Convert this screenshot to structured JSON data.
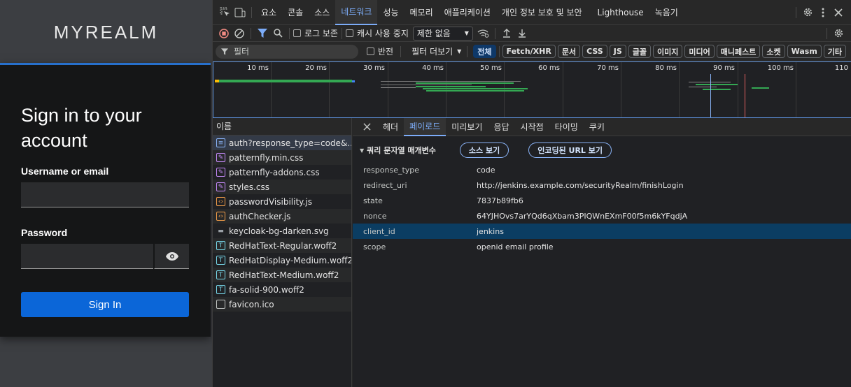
{
  "login": {
    "brand": "MYREALM",
    "heading": "Sign in to your account",
    "username_label": "Username or email",
    "username_value": "",
    "password_label": "Password",
    "password_value": "",
    "signin_label": "Sign In"
  },
  "devtools": {
    "tabs": [
      "요소",
      "콘솔",
      "소스",
      "네트워크",
      "성능",
      "메모리",
      "애플리케이션",
      "개인 정보 보호 및 보안",
      "Lighthouse",
      "녹음기"
    ],
    "active_tab": "네트워크",
    "toolbar": {
      "preserve_log": "로그 보존",
      "disable_cache": "캐시 사용 중지",
      "throttle": "제한 없음"
    },
    "filterbar": {
      "filter_placeholder": "필터",
      "invert": "반전",
      "more_filters": "필터 더보기",
      "chips": [
        "전체",
        "Fetch/XHR",
        "문서",
        "CSS",
        "JS",
        "글꼴",
        "이미지",
        "미디어",
        "매니페스트",
        "소켓",
        "Wasm",
        "기타"
      ],
      "active_chip": "전체"
    },
    "timeline": {
      "ticks": [
        "10 ms",
        "20 ms",
        "30 ms",
        "40 ms",
        "50 ms",
        "60 ms",
        "70 ms",
        "80 ms",
        "90 ms",
        "100 ms",
        "110"
      ]
    },
    "requests": {
      "header": "이름",
      "items": [
        {
          "name": "auth?response_type=code&...",
          "type": "doc"
        },
        {
          "name": "patternfly.min.css",
          "type": "css"
        },
        {
          "name": "patternfly-addons.css",
          "type": "css"
        },
        {
          "name": "styles.css",
          "type": "css"
        },
        {
          "name": "passwordVisibility.js",
          "type": "js"
        },
        {
          "name": "authChecker.js",
          "type": "js"
        },
        {
          "name": "keycloak-bg-darken.svg",
          "type": "img"
        },
        {
          "name": "RedHatText-Regular.woff2",
          "type": "font"
        },
        {
          "name": "RedHatDisplay-Medium.woff2",
          "type": "font"
        },
        {
          "name": "RedHatText-Medium.woff2",
          "type": "font"
        },
        {
          "name": "fa-solid-900.woff2",
          "type": "font"
        },
        {
          "name": "favicon.ico",
          "type": "other"
        }
      ]
    },
    "detail": {
      "tabs": [
        "헤더",
        "페이로드",
        "미리보기",
        "응답",
        "시작점",
        "타이밍",
        "쿠키"
      ],
      "active_tab": "페이로드",
      "section_title": "쿼리 문자열 매개변수",
      "view_source": "소스 보기",
      "view_url_encoded": "인코딩된 URL 보기",
      "params": [
        {
          "key": "response_type",
          "value": "code"
        },
        {
          "key": "redirect_uri",
          "value": "http://jenkins.example.com/securityRealm/finishLogin"
        },
        {
          "key": "state",
          "value": "7837b89fb6"
        },
        {
          "key": "nonce",
          "value": "64YJHOvs7arYQd6qXbam3PIQWnEXmF00f5m6kYFqdjA"
        },
        {
          "key": "client_id",
          "value": "jenkins"
        },
        {
          "key": "scope",
          "value": "openid email profile"
        }
      ],
      "selected_param": "client_id"
    }
  }
}
